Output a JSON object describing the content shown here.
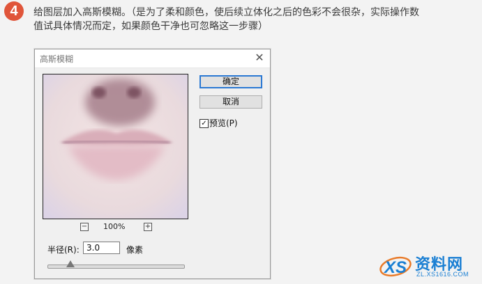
{
  "step": {
    "number": "4",
    "line1": "给图层加入高斯模糊。（是为了柔和颜色，使后续立体化之后的色彩不会很杂，实际操作数",
    "line2": "值试具体情况而定，如果颜色干净也可忽略这一步骤）"
  },
  "dialog": {
    "title": "高斯模糊",
    "close_glyph": "✕",
    "ok_label": "确定",
    "cancel_label": "取消",
    "preview_checked": true,
    "check_glyph": "✓",
    "preview_label": "预览(P)",
    "zoom": {
      "minus": "−",
      "value": "100%",
      "plus": "+"
    },
    "radius": {
      "label": "半径(R):",
      "value": "3.0",
      "unit": "像素",
      "slider_fraction": 0.17
    }
  },
  "watermark": {
    "logo_letters": "XS",
    "text": "资料网",
    "url": "ZL.XS1616.COM"
  },
  "colors": {
    "badge": "#e0553a",
    "accent_button": "#2a78d3",
    "watermark": "#1a7fd3"
  }
}
